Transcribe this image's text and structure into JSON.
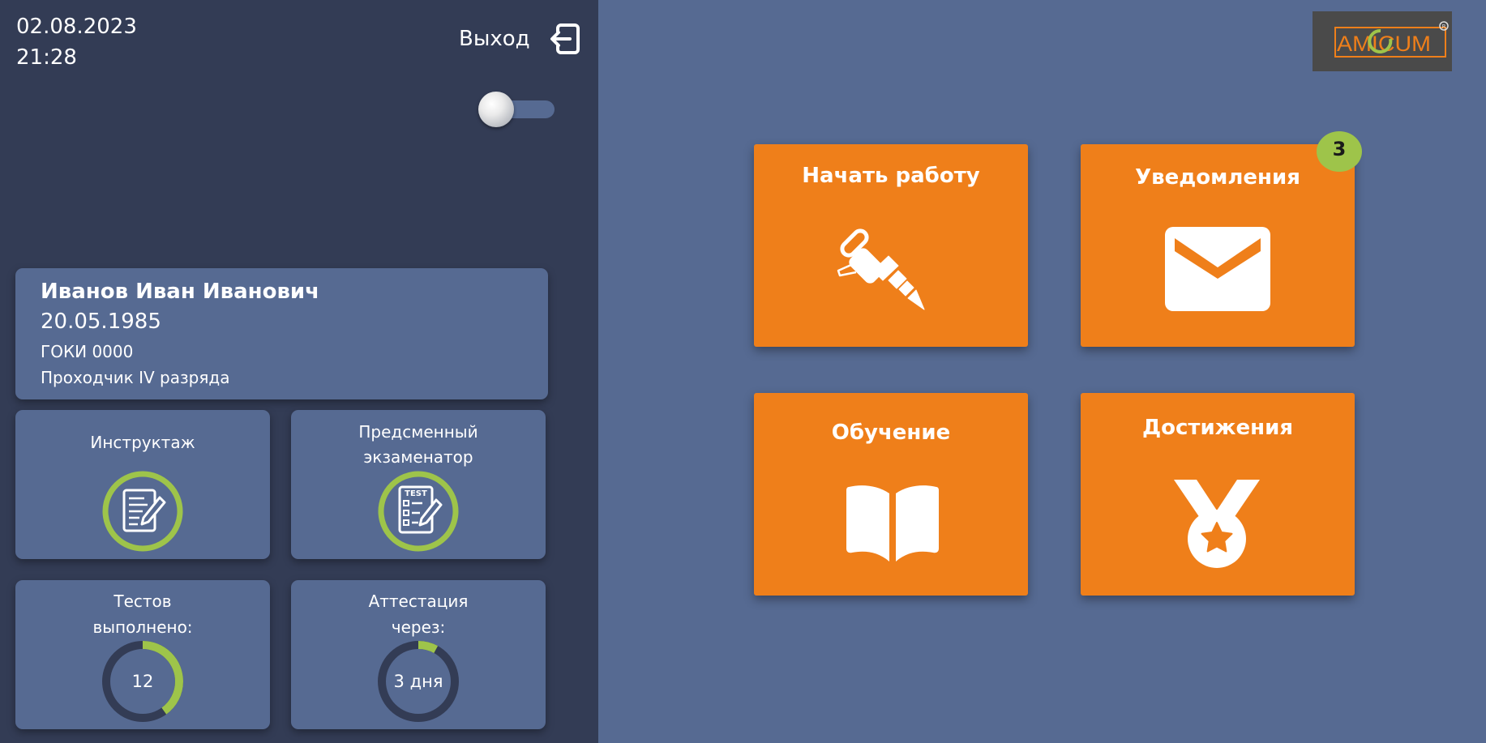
{
  "header": {
    "date": "02.08.2023",
    "time": "21:28",
    "exit_label": "Выход"
  },
  "profile": {
    "name": "Иванов Иван Иванович",
    "birth_date": "20.05.1985",
    "organization": "ГОКИ 0000",
    "position": "Проходчик IV разряда"
  },
  "widgets": {
    "briefing": {
      "title": "Инструктаж"
    },
    "exam": {
      "title_line1": "Предсменный",
      "title_line2": "экзаменатор",
      "icon_text": "TEST"
    },
    "tests": {
      "title_line1": "Тестов",
      "title_line2": "выполнено:",
      "value": "12",
      "progress": 0.4
    },
    "attestation": {
      "title_line1": "Аттестация",
      "title_line2": "через:",
      "value": "3 дня",
      "progress": 0.08
    }
  },
  "tiles": {
    "start_work": {
      "label": "Начать работу",
      "icon": "jackhammer-icon"
    },
    "notifications": {
      "label": "Уведомления",
      "icon": "envelope-icon",
      "badge": "3"
    },
    "learning": {
      "label": "Обучение",
      "icon": "book-icon"
    },
    "achievements": {
      "label": "Достижения",
      "icon": "medal-icon"
    }
  },
  "logo": {
    "text": "AMICUM"
  },
  "colors": {
    "sidebar_bg": "#333c55",
    "main_bg": "#566a92",
    "tile_orange": "#ef7f1a",
    "accent_green": "#9ec44a",
    "donut_track": "#333c55"
  }
}
